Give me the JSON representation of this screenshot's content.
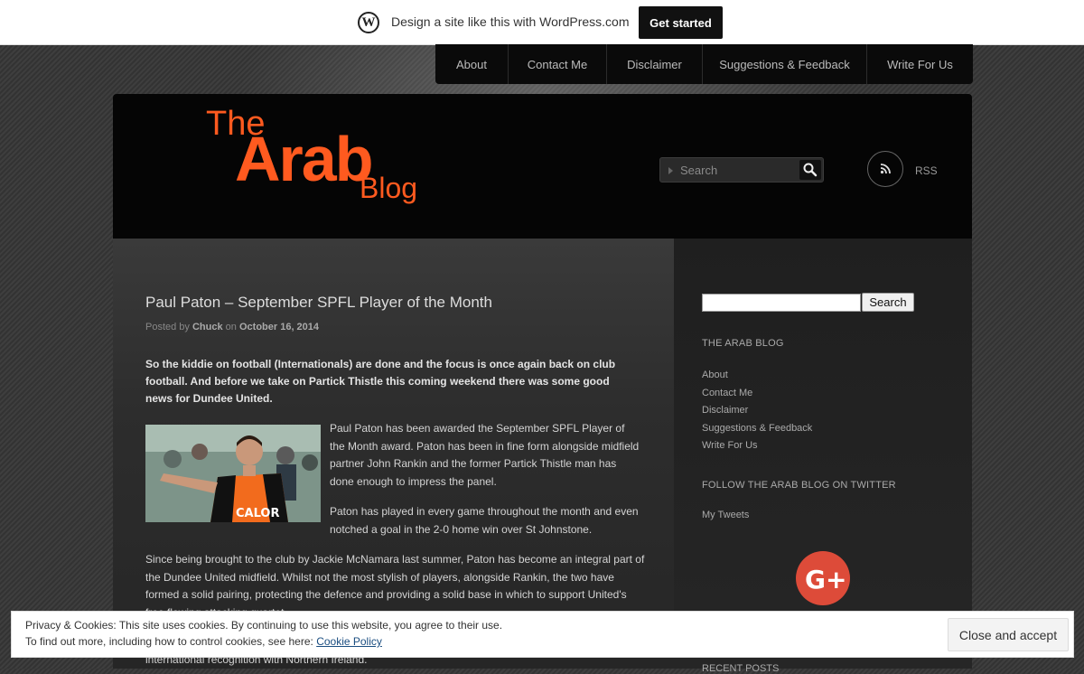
{
  "wpbar": {
    "logo_glyph": "W",
    "text": "Design a site like this with WordPress.com",
    "cta": "Get started"
  },
  "nav": {
    "items": [
      "About",
      "Contact Me",
      "Disclaimer",
      "Suggestions & Feedback",
      "Write For Us"
    ]
  },
  "header": {
    "logo": {
      "line1": "The",
      "line2": "Arab",
      "line3": "Blog",
      "color": "#ff5a1f"
    },
    "search_placeholder": "Search",
    "rss_label": "RSS"
  },
  "post": {
    "title": "Paul Paton – September SPFL Player of the Month",
    "meta_prefix": "Posted by",
    "author": "Chuck",
    "meta_on": "on",
    "date": "October 16, 2014",
    "intro": "So the kiddie on football (Internationals) are done and the focus is once again back on club football.  And before we take on Partick Thistle this coming weekend there was some good news for Dundee United.",
    "p1": "Paul Paton has been awarded the September SPFL Player of the Month award.  Paton has been in fine form alongside midfield partner John Rankin and the former Partick Thistle man has done enough to impress the panel.",
    "p2": "Paton has played in every game throughout the month and even notched a goal in the 2-0 home win over St Johnstone.",
    "p3": "Since being brought to the club by Jackie McNamara last summer, Paton has become an integral part of the Dundee United midfield.  Whilst not the most stylish of players, alongside Rankin, the two have formed a solid pairing, protecting the defence and providing a solid base in which to support United's free flowing attacking quartet.",
    "p4": "international recognition with Northern Ireland.",
    "photo_shirt_text": "CALOR"
  },
  "sidebar": {
    "search_button": "Search",
    "widget1_title": "THE ARAB BLOG",
    "links": [
      "About",
      "Contact Me",
      "Disclaimer",
      "Suggestions & Feedback",
      "Write For Us"
    ],
    "widget2_title": "FOLLOW THE ARAB BLOG ON TWITTER",
    "tweets_link": "My Tweets",
    "gplus_label": "G+",
    "recent_title": "RECENT POSTS"
  },
  "cookie": {
    "line1": "Privacy & Cookies: This site uses cookies. By continuing to use this website, you agree to their use.",
    "line2_prefix": "To find out more, including how to control cookies, see here: ",
    "policy_link": "Cookie Policy",
    "close_button": "Close and accept"
  }
}
